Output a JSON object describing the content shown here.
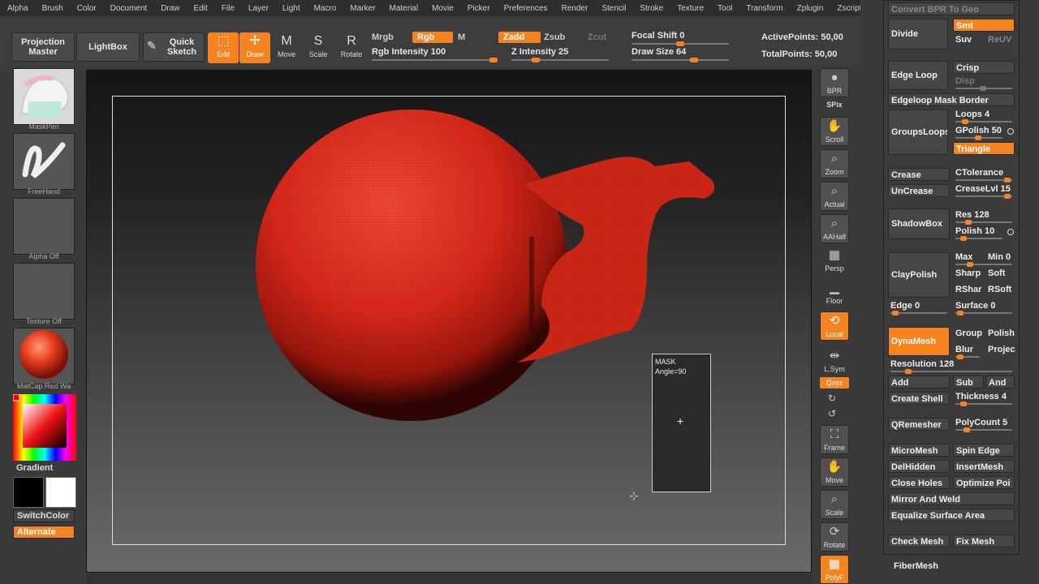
{
  "menu": [
    "Alpha",
    "Brush",
    "Color",
    "Document",
    "Draw",
    "Edit",
    "File",
    "Layer",
    "Light",
    "Macro",
    "Marker",
    "Material",
    "Movie",
    "Picker",
    "Preferences",
    "Render",
    "Stencil",
    "Stroke",
    "Texture",
    "Tool",
    "Transform",
    "Zplugin",
    "Zscript"
  ],
  "toolbar": {
    "projection_master_1": "Projection",
    "projection_master_2": "Master",
    "lightbox": "LightBox",
    "quick_sketch_1": "Quick",
    "quick_sketch_2": "Sketch",
    "edit": "Edit",
    "draw": "Draw",
    "move": "Move",
    "scale": "Scale",
    "rotate": "Rotate",
    "mrgb": "Mrgb",
    "rgb": "Rgb",
    "m": "M",
    "rgb_intensity": "Rgb Intensity 100",
    "zadd": "Zadd",
    "zsub": "Zsub",
    "zcut": "Zcut",
    "z_intensity": "Z Intensity 25",
    "focal_shift": "Focal Shift 0",
    "draw_size": "Draw Size 64",
    "active_points": "ActivePoints: 50,00",
    "total_points": "TotalPoints: 50,00",
    "rgb_intensity_level": 1.0,
    "z_intensity_level": 0.25,
    "focal_shift_level": 0.5,
    "draw_size_level": 0.64
  },
  "lefttray": {
    "brush": "MaskPen",
    "stroke": "FreeHand",
    "alpha": "Alpha Off",
    "texture": "Texture Off",
    "material": "MatCap Red Wa",
    "gradient": "Gradient",
    "switch_color": "SwitchColor",
    "alternate": "Alternate"
  },
  "canvas": {
    "mask_title": "MASK",
    "mask_angle": "Angle=90",
    "mask_cursor": "+"
  },
  "shelf": {
    "bpr": "BPR",
    "spix": "SPix",
    "scroll": "Scroll",
    "zoom": "Zoom",
    "actual": "Actual",
    "aahalf": "AAHalf",
    "persp": "Persp",
    "floor": "Floor",
    "local": "Local",
    "lsym": "L.Sym",
    "xyz": "Qxyz",
    "frame": "Frame",
    "move": "Move",
    "scale": "Scale",
    "rotate": "Rotate",
    "polyf": "PolyF"
  },
  "panel": {
    "convert": "Convert BPR To Geo",
    "divide": "Divide",
    "smt": "Smt",
    "suv": "Suv",
    "reuv": "ReUV",
    "edge_loop": "Edge Loop",
    "crisp": "Crisp",
    "disp": "Disp",
    "edgeloop_mask_border": "Edgeloop Mask Border",
    "groups_loops": "GroupsLoops",
    "loops": "Loops 4",
    "gpolish": "GPolish 50",
    "triangle": "Triangle",
    "crease": "Crease",
    "ctolerance": "CTolerance",
    "uncrease": "UnCrease",
    "crease_lvl": "CreaseLvl 15",
    "shadowbox": "ShadowBox",
    "res": "Res 128",
    "polish": "Polish 10",
    "claypolish": "ClayPolish",
    "max": "Max",
    "min": "Min 0",
    "sharp": "Sharp",
    "soft": "Soft",
    "rshar": "RShar",
    "rsoft": "RSoft",
    "edge": "Edge 0",
    "surface": "Surface 0",
    "dynamesh": "DynaMesh",
    "group": "Group",
    "polish2": "Polish",
    "blur": "Blur",
    "projec": "Projec",
    "resolution": "Resolution 128",
    "add": "Add",
    "sub": "Sub",
    "and": "And",
    "create_shell": "Create Shell",
    "thickness": "Thickness 4",
    "qremesher": "QRemesher",
    "polycount": "PolyCount 5",
    "micromesh": "MicroMesh",
    "spin_edge": "Spin Edge",
    "delhidden": "DelHidden",
    "insertmesh": "InsertMesh",
    "close_holes": "Close Holes",
    "optimize": "Optimize Poi",
    "mirror_weld": "Mirror And Weld",
    "equalize": "Equalize Surface Area",
    "check_mesh": "Check Mesh",
    "fix_mesh": "Fix Mesh",
    "fibermesh": "FiberMesh"
  },
  "colors": {
    "accent": "#f58420",
    "model_red": "#d8281a",
    "bg": "#3a3a3a"
  }
}
